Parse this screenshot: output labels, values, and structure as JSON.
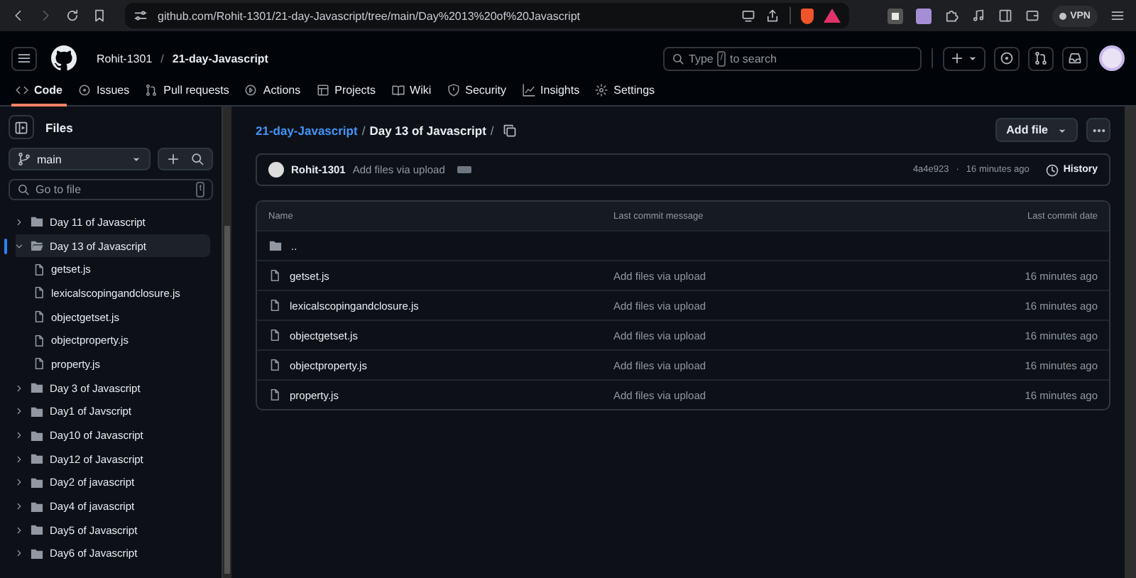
{
  "browser": {
    "url": "github.com/Rohit-1301/21-day-Javascript/tree/main/Day%2013%20of%20Javascript",
    "vpn_label": "VPN"
  },
  "header": {
    "owner": "Rohit-1301",
    "separator": "/",
    "repo": "21-day-Javascript",
    "search": {
      "before": "Type",
      "key": "/",
      "after": "to search"
    }
  },
  "repo_tabs": [
    {
      "label": "Code",
      "selected": true
    },
    {
      "label": "Issues",
      "selected": false
    },
    {
      "label": "Pull requests",
      "selected": false
    },
    {
      "label": "Actions",
      "selected": false
    },
    {
      "label": "Projects",
      "selected": false
    },
    {
      "label": "Wiki",
      "selected": false
    },
    {
      "label": "Security",
      "selected": false
    },
    {
      "label": "Insights",
      "selected": false
    },
    {
      "label": "Settings",
      "selected": false
    }
  ],
  "sidebar": {
    "title": "Files",
    "branch": "main",
    "go_to_file": {
      "placeholder": "Go to file",
      "shortcut": "t"
    },
    "tree": [
      {
        "name": "Day 11 of Javascript",
        "kind": "folder",
        "expanded": false,
        "selected": false
      },
      {
        "name": "Day 13 of Javascript",
        "kind": "folder",
        "expanded": true,
        "selected": true,
        "children": [
          {
            "name": "getset.js",
            "kind": "file",
            "selected": false
          },
          {
            "name": "lexicalscopingandclosure.js",
            "kind": "file",
            "selected": false
          },
          {
            "name": "objectgetset.js",
            "kind": "file",
            "selected": false
          },
          {
            "name": "objectproperty.js",
            "kind": "file",
            "selected": false
          },
          {
            "name": "property.js",
            "kind": "file",
            "selected": false
          }
        ]
      },
      {
        "name": "Day 3 of Javascript",
        "kind": "folder",
        "expanded": false,
        "selected": false
      },
      {
        "name": "Day1 of Javscript",
        "kind": "folder",
        "expanded": false,
        "selected": false
      },
      {
        "name": "Day10 of Javascript",
        "kind": "folder",
        "expanded": false,
        "selected": false
      },
      {
        "name": "Day12 of Javascript",
        "kind": "folder",
        "expanded": false,
        "selected": false
      },
      {
        "name": "Day2 of javascript",
        "kind": "folder",
        "expanded": false,
        "selected": false
      },
      {
        "name": "Day4 of javascript",
        "kind": "folder",
        "expanded": false,
        "selected": false
      },
      {
        "name": "Day5 of Javascript",
        "kind": "folder",
        "expanded": false,
        "selected": false
      },
      {
        "name": "Day6 of Javascript",
        "kind": "folder",
        "expanded": false,
        "selected": false
      }
    ]
  },
  "breadcrumb": {
    "repo_link": "21-day-Javascript",
    "separator": "/",
    "current": "Day 13 of Javascript",
    "trailing": "/"
  },
  "add_file_button": "Add file",
  "commit": {
    "author": "Rohit-1301",
    "message": "Add files via upload",
    "sha": "4a4e923",
    "dot": "·",
    "time": "16 minutes ago",
    "history": "History"
  },
  "table": {
    "columns": [
      "Name",
      "Last commit message",
      "Last commit date"
    ],
    "rows": [
      {
        "kind": "parent",
        "name": ".."
      },
      {
        "kind": "file",
        "name": "getset.js",
        "message": "Add files via upload",
        "date": "16 minutes ago"
      },
      {
        "kind": "file",
        "name": "lexicalscopingandclosure.js",
        "message": "Add files via upload",
        "date": "16 minutes ago"
      },
      {
        "kind": "file",
        "name": "objectgetset.js",
        "message": "Add files via upload",
        "date": "16 minutes ago"
      },
      {
        "kind": "file",
        "name": "objectproperty.js",
        "message": "Add files via upload",
        "date": "16 minutes ago"
      },
      {
        "kind": "file",
        "name": "property.js",
        "message": "Add files via upload",
        "date": "16 minutes ago"
      }
    ]
  }
}
